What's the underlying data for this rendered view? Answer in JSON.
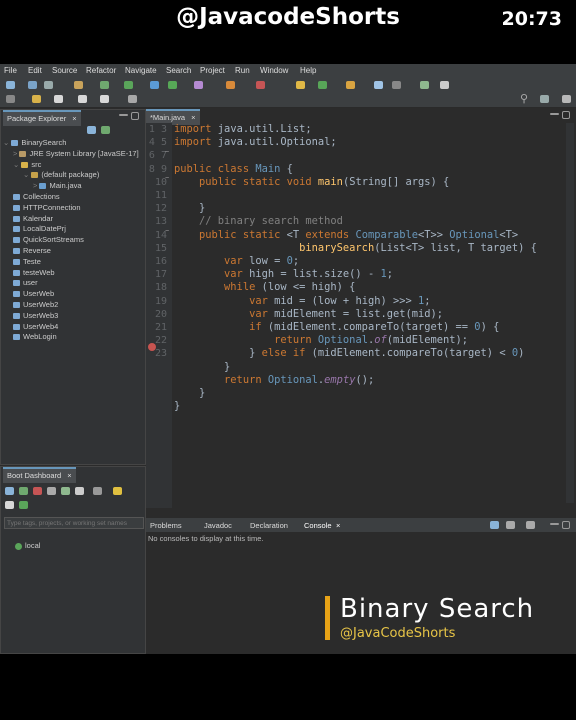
{
  "banner": {
    "handle": "@JavacodeShorts",
    "time": "20:73"
  },
  "menu": [
    "File",
    "Edit",
    "Source",
    "Refactor",
    "Navigate",
    "Search",
    "Project",
    "Run",
    "Window",
    "Help"
  ],
  "package_explorer": {
    "tab": "Package Explorer",
    "items": [
      {
        "label": "BinarySearch",
        "level": 0,
        "kind": "project",
        "expanded": true
      },
      {
        "label": "JRE System Library [JavaSE-17]",
        "level": 1,
        "kind": "lib"
      },
      {
        "label": "src",
        "level": 1,
        "kind": "folder",
        "expanded": true
      },
      {
        "label": "(default package)",
        "level": 2,
        "kind": "package",
        "expanded": true
      },
      {
        "label": "Main.java",
        "level": 3,
        "kind": "java"
      },
      {
        "label": "Collections",
        "level": 0,
        "kind": "project"
      },
      {
        "label": "HTTPConnection",
        "level": 0,
        "kind": "project"
      },
      {
        "label": "Kalendar",
        "level": 0,
        "kind": "project"
      },
      {
        "label": "LocalDatePrj",
        "level": 0,
        "kind": "project"
      },
      {
        "label": "QuickSortStreams",
        "level": 0,
        "kind": "project"
      },
      {
        "label": "Reverse",
        "level": 0,
        "kind": "project"
      },
      {
        "label": "Teste",
        "level": 0,
        "kind": "project"
      },
      {
        "label": "testeWeb",
        "level": 0,
        "kind": "project"
      },
      {
        "label": "user",
        "level": 0,
        "kind": "project"
      },
      {
        "label": "UserWeb",
        "level": 0,
        "kind": "project"
      },
      {
        "label": "UserWeb2",
        "level": 0,
        "kind": "project"
      },
      {
        "label": "UserWeb3",
        "level": 0,
        "kind": "project"
      },
      {
        "label": "UserWeb4",
        "level": 0,
        "kind": "project"
      },
      {
        "label": "WebLogin",
        "level": 0,
        "kind": "project"
      }
    ]
  },
  "boot_dashboard": {
    "tab": "Boot Dashboard",
    "filter_placeholder": "Type tags, projects, or working set names",
    "items": [
      "local"
    ]
  },
  "editor": {
    "tab": "*Main.java",
    "line_numbers": [
      "1",
      "3",
      "4",
      "5",
      "6",
      "7",
      "8",
      "9",
      "10",
      "11",
      "12",
      "13",
      "14",
      "15",
      "16",
      "17",
      "18",
      "19",
      "20",
      "21",
      "22",
      "23"
    ]
  },
  "console": {
    "tabs": [
      "Problems",
      "Javadoc",
      "Declaration",
      "Console"
    ],
    "message": "No consoles to display at this time."
  },
  "overlay": {
    "title": "Binary Search",
    "subtitle": "@JavaCodeShorts"
  }
}
